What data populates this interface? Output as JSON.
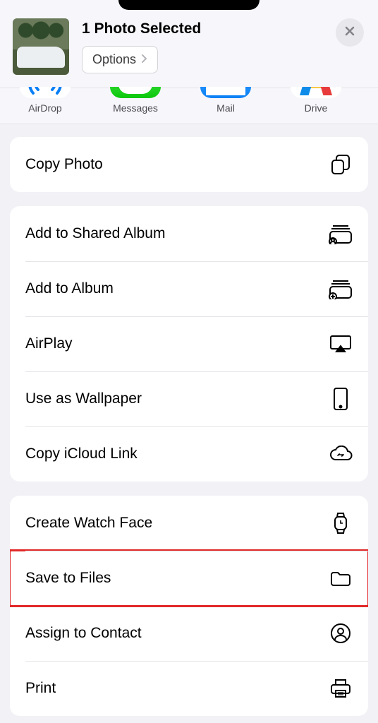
{
  "header": {
    "title": "1 Photo Selected",
    "options_label": "Options"
  },
  "apps": {
    "airdrop": "AirDrop",
    "messages": "Messages",
    "mail": "Mail",
    "drive": "Drive"
  },
  "actions": {
    "copy_photo": "Copy Photo",
    "add_shared_album": "Add to Shared Album",
    "add_album": "Add to Album",
    "airplay": "AirPlay",
    "use_wallpaper": "Use as Wallpaper",
    "copy_icloud": "Copy iCloud Link",
    "create_watch_face": "Create Watch Face",
    "save_to_files": "Save to Files",
    "assign_contact": "Assign to Contact",
    "print": "Print"
  }
}
